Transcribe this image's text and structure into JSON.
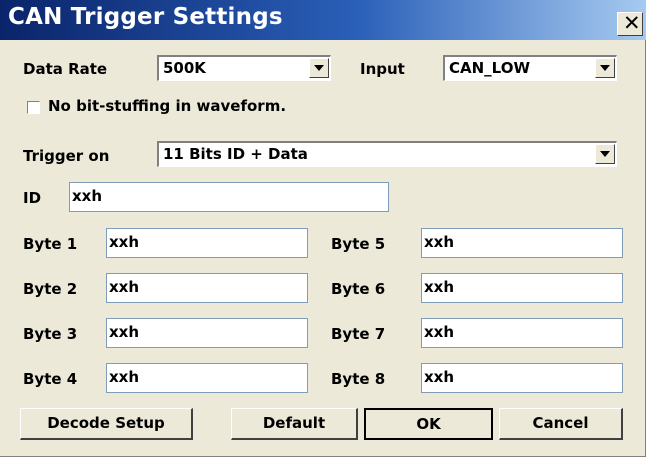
{
  "window": {
    "title": "CAN Trigger Settings",
    "close_glyph": "✕"
  },
  "data_rate": {
    "label": "Data Rate",
    "value": "500K"
  },
  "input": {
    "label": "Input",
    "value": "CAN_LOW"
  },
  "bit_stuffing": {
    "label": "No bit-stuffing in waveform.",
    "checked": false
  },
  "trigger_on": {
    "label": "Trigger on",
    "value": "11 Bits ID + Data"
  },
  "id_field": {
    "label": "ID",
    "value": "xxh"
  },
  "bytes": [
    {
      "label": "Byte 1",
      "value": "xxh"
    },
    {
      "label": "Byte 2",
      "value": "xxh"
    },
    {
      "label": "Byte 3",
      "value": "xxh"
    },
    {
      "label": "Byte 4",
      "value": "xxh"
    },
    {
      "label": "Byte 5",
      "value": "xxh"
    },
    {
      "label": "Byte 6",
      "value": "xxh"
    },
    {
      "label": "Byte 7",
      "value": "xxh"
    },
    {
      "label": "Byte 8",
      "value": "xxh"
    }
  ],
  "buttons": {
    "decode_setup": "Decode Setup",
    "default": "Default",
    "ok": "OK",
    "cancel": "Cancel"
  }
}
